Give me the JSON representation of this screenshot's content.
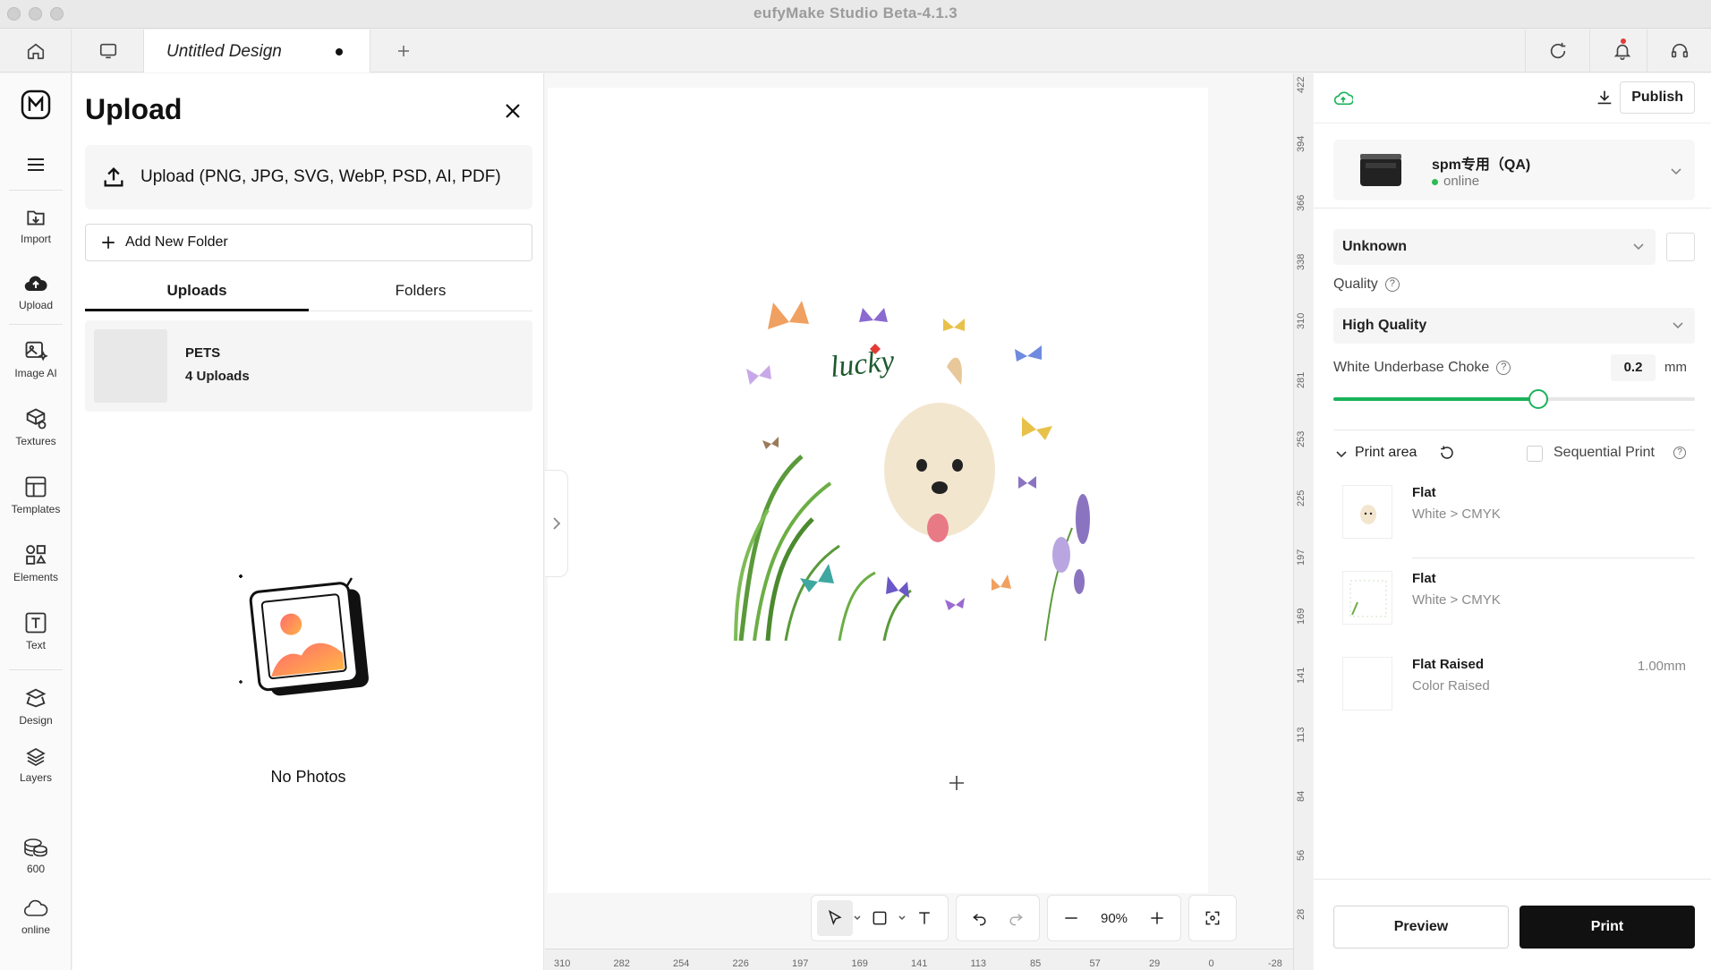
{
  "window": {
    "title": "eufyMake Studio Beta-4.1.3"
  },
  "tabs": {
    "active_title": "Untitled Design"
  },
  "rail": {
    "items": [
      {
        "label": "Import",
        "icon": "import-icon"
      },
      {
        "label": "Upload",
        "icon": "cloud-upload-icon"
      },
      {
        "label": "Image AI",
        "icon": "image-ai-icon"
      },
      {
        "label": "Textures",
        "icon": "textures-icon"
      },
      {
        "label": "Templates",
        "icon": "templates-icon"
      },
      {
        "label": "Elements",
        "icon": "elements-icon"
      },
      {
        "label": "Text",
        "icon": "text-icon"
      },
      {
        "label": "Design",
        "icon": "design-icon"
      },
      {
        "label": "Layers",
        "icon": "layers-icon"
      }
    ],
    "credits": "600",
    "status": "online"
  },
  "upload_panel": {
    "title": "Upload",
    "upload_label": "Upload (PNG, JPG, SVG, WebP, PSD, AI, PDF)",
    "add_folder_label": "Add New Folder",
    "tab_uploads": "Uploads",
    "tab_folders": "Folders",
    "folder": {
      "name": "PETS",
      "count": "4 Uploads"
    },
    "empty_text": "No Photos"
  },
  "canvas": {
    "artwork_text": "lucky",
    "zoom": "90%",
    "ruler_x": [
      "310",
      "282",
      "254",
      "226",
      "197",
      "169",
      "141",
      "113",
      "85",
      "57",
      "29",
      "0",
      "-28"
    ],
    "ruler_y": [
      "422",
      "394",
      "366",
      "338",
      "310",
      "281",
      "253",
      "225",
      "197",
      "169",
      "141",
      "113",
      "84",
      "56",
      "28"
    ]
  },
  "right_panel": {
    "publish_label": "Publish",
    "device": {
      "name": "spm专用（QA)",
      "status": "online"
    },
    "material_select": "Unknown",
    "quality_label": "Quality",
    "quality_value": "High Quality",
    "choke_label": "White Underbase Choke",
    "choke_value": "0.2",
    "choke_unit": "mm",
    "choke_fraction": 0.9,
    "print_area_label": "Print area",
    "sequential_label": "Sequential Print",
    "print_areas": [
      {
        "name": "Flat",
        "sub": "White > CMYK",
        "size": ""
      },
      {
        "name": "Flat",
        "sub": "White > CMYK",
        "size": ""
      },
      {
        "name": "Flat Raised",
        "sub": "Color Raised",
        "size": "1.00mm"
      }
    ],
    "preview_label": "Preview",
    "print_label": "Print"
  },
  "colors": {
    "accent": "#19b35a",
    "print_button": "#111111"
  }
}
